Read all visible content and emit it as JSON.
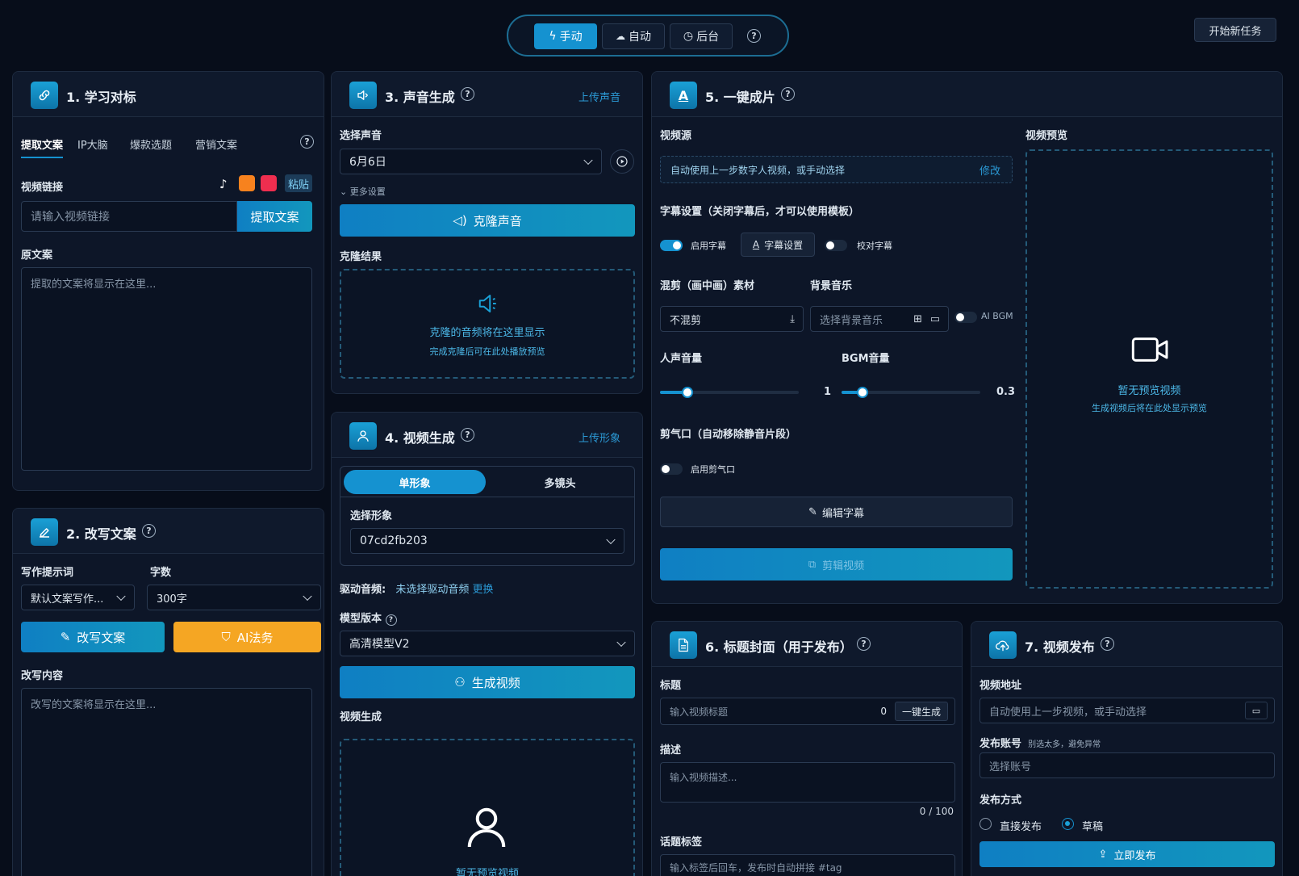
{
  "topbar": {
    "mode_manual": "手动",
    "mode_auto": "自动",
    "mode_background": "后台",
    "new_task": "开始新任务"
  },
  "p1": {
    "title": "1. 学习对标",
    "tabs": [
      "提取文案",
      "IP大脑",
      "爆款选题",
      "营销文案"
    ],
    "video_link_label": "视频链接",
    "paste": "粘贴",
    "link_placeholder": "请输入视频链接",
    "extract_button": "提取文案",
    "source_label": "原文案",
    "source_placeholder": "提取的文案将显示在这里..."
  },
  "p2": {
    "title": "2. 改写文案",
    "prompt_label": "写作提示词",
    "count_label": "字数",
    "prompt_value": "默认文案写作...",
    "count_value": "300字",
    "rewrite_button": "改写文案",
    "ai_button": "AI法务",
    "content_label": "改写内容",
    "content_placeholder": "改写的文案将显示在这里..."
  },
  "p3": {
    "title": "3. 声音生成",
    "upload_link": "上传声音",
    "select_label": "选择声音",
    "voice_value": "6月6日",
    "more_settings": "更多设置",
    "clone_button": "克隆声音",
    "result_label": "克隆结果",
    "result_main": "克隆的音频将在这里显示",
    "result_sub": "完成克隆后可在此处播放预览"
  },
  "p4": {
    "title": "4. 视频生成",
    "upload_link": "上传形象",
    "seg_single": "单形象",
    "seg_multi": "多镜头",
    "avatar_label": "选择形象",
    "avatar_value": "07cd2fb203",
    "drive_label": "驱动音频:",
    "drive_value": "未选择驱动音频",
    "drive_change": "更换",
    "model_label": "模型版本",
    "model_value": "高清模型V2",
    "gen_button": "生成视频",
    "gen_label": "视频生成",
    "preview_empty": "暂无预览视频"
  },
  "p5": {
    "title": "5. 一键成片",
    "source_label": "视频源",
    "source_value": "自动使用上一步数字人视频，或手动选择",
    "modify": "修改",
    "subtitle_label": "字幕设置（关闭字幕后，才可以使用模板）",
    "enable_subtitle": "启用字幕",
    "subtitle_settings": "字幕设置",
    "proofread": "校对字幕",
    "pip_label": "混剪（画中画）素材",
    "bgm_label": "背景音乐",
    "pip_value": "不混剪",
    "bgm_placeholder": "选择背景音乐",
    "ai_bgm": "AI BGM",
    "voice_vol_label": "人声音量",
    "bgm_vol_label": "BGM音量",
    "voice_vol": "1",
    "bgm_vol": "0.3",
    "voice_vol_fraction": 0.2,
    "bgm_vol_fraction": 0.15,
    "cut_label": "剪气口（自动移除静音片段）",
    "enable_cut": "启用剪气口",
    "edit_subtitle": "编辑字幕",
    "edit_video": "剪辑视频",
    "preview_label": "视频预览",
    "preview_main": "暂无预览视频",
    "preview_sub": "生成视频后将在此处显示预览"
  },
  "p6": {
    "title": "6. 标题封面（用于发布）",
    "title_label": "标题",
    "title_placeholder": "输入视频标题",
    "title_count": "0",
    "gen_button": "一键生成",
    "desc_label": "描述",
    "desc_placeholder": "输入视频描述...",
    "desc_count": "0 / 100",
    "tag_label": "话题标签",
    "tag_placeholder": "输入标签后回车，发布时自动拼接 #tag"
  },
  "p7": {
    "title": "7. 视频发布",
    "addr_label": "视频地址",
    "addr_placeholder": "自动使用上一步视频，或手动选择",
    "account_label": "发布账号",
    "account_hint": "别选太多，避免异常",
    "account_placeholder": "选择账号",
    "method_label": "发布方式",
    "direct": "直接发布",
    "draft": "草稿",
    "publish_button": "立即发布"
  },
  "colors": {
    "accent": "#1592d0",
    "orange": "#f5a623",
    "background": "#070d1a"
  }
}
